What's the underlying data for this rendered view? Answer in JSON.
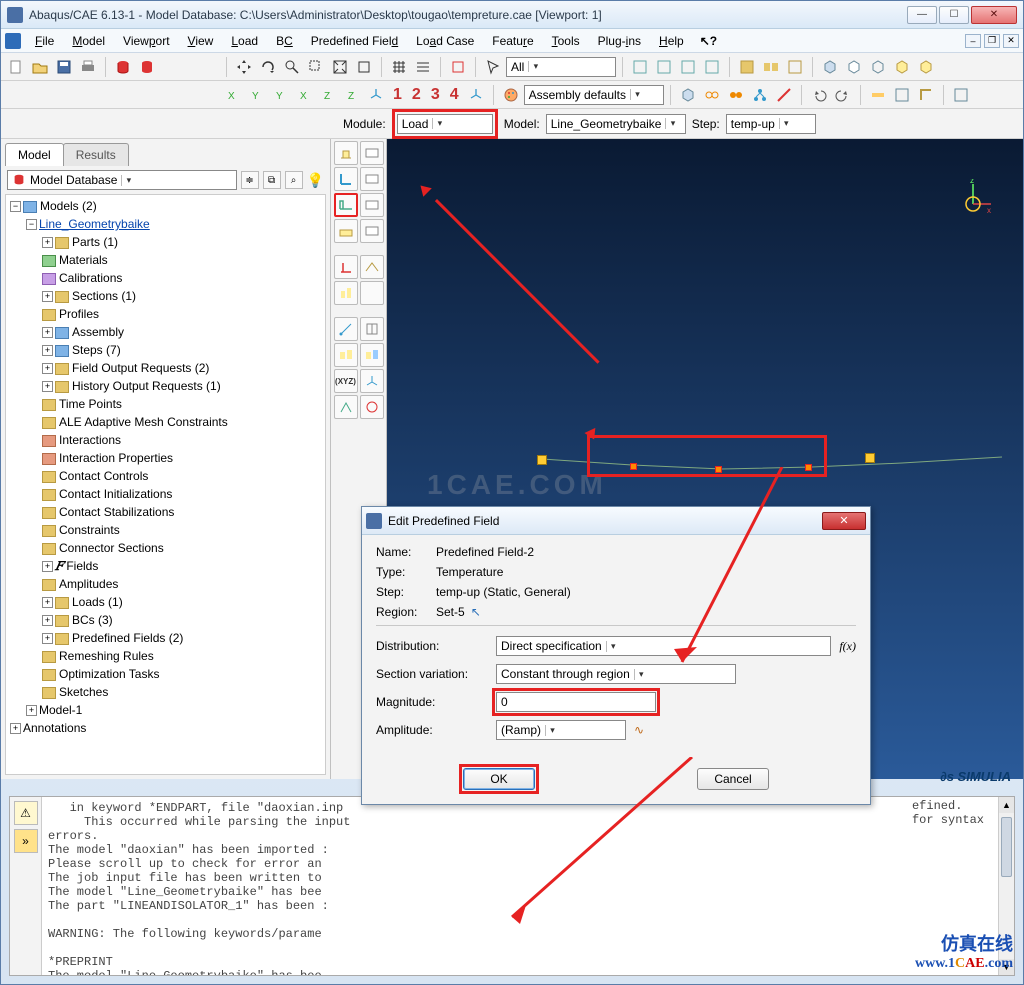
{
  "window": {
    "title": "Abaqus/CAE 6.13-1 - Model Database: C:\\Users\\Administrator\\Desktop\\tougao\\tempreture.cae [Viewport: 1]",
    "min": "—",
    "max": "☐",
    "close": "✕"
  },
  "menus": [
    "File",
    "Model",
    "Viewport",
    "View",
    "Load",
    "BC",
    "Predefined Field",
    "Load Case",
    "Feature",
    "Tools",
    "Plug-ins",
    "Help"
  ],
  "help_cursor": "↖?",
  "view_combo": "All",
  "assembly_combo": "Assembly defaults",
  "steps_nums": [
    "1",
    "2",
    "3",
    "4"
  ],
  "context": {
    "module_label": "Module:",
    "module_value": "Load",
    "model_label": "Model:",
    "model_value": "Line_Geometrybaike",
    "step_label": "Step:",
    "step_value": "temp-up"
  },
  "side": {
    "tab_model": "Model",
    "tab_results": "Results",
    "db_label": "Model Database"
  },
  "tree": {
    "root": "Models (2)",
    "model_a": "Line_Geometrybaike",
    "parts": "Parts (1)",
    "materials": "Materials",
    "calibrations": "Calibrations",
    "sections": "Sections (1)",
    "profiles": "Profiles",
    "assembly": "Assembly",
    "steps": "Steps (7)",
    "for": "Field Output Requests (2)",
    "hor": "History Output Requests (1)",
    "timepoints": "Time Points",
    "ale": "ALE Adaptive Mesh Constraints",
    "interactions": "Interactions",
    "interprops": "Interaction Properties",
    "contactctrls": "Contact Controls",
    "contactinits": "Contact Initializations",
    "contactstabs": "Contact Stabilizations",
    "constraints": "Constraints",
    "connsecs": "Connector Sections",
    "fields": "Fields",
    "amplitudes": "Amplitudes",
    "loads": "Loads (1)",
    "bcs": "BCs (3)",
    "predef": "Predefined Fields (2)",
    "remesh": "Remeshing Rules",
    "opt": "Optimization Tasks",
    "sketches": "Sketches",
    "model_b": "Model-1",
    "annotations": "Annotations"
  },
  "tool_xyz": "(XYZ)",
  "dialog": {
    "title": "Edit Predefined Field",
    "name_k": "Name:",
    "name_v": "Predefined Field-2",
    "type_k": "Type:",
    "type_v": "Temperature",
    "step_k": "Step:",
    "step_v": "temp-up (Static, General)",
    "region_k": "Region:",
    "region_v": "Set-5",
    "dist_k": "Distribution:",
    "dist_v": "Direct specification",
    "secv_k": "Section variation:",
    "secv_v": "Constant through region",
    "mag_k": "Magnitude:",
    "mag_v": "0",
    "amp_k": "Amplitude:",
    "amp_v": "(Ramp)",
    "fx": "f(x)",
    "ok": "OK",
    "cancel": "Cancel"
  },
  "msg_lines": "   in keyword *ENDPART, file \"daoxian.inp\n     This occurred while parsing the input\nerrors.\nThe model \"daoxian\" has been imported :\nPlease scroll up to check for error an\nThe job input file has been written to\nThe model \"Line_Geometrybaike\" has bee\nThe part \"LINEANDISOLATOR_1\" has been :\n\nWARNING: The following keywords/parame\n\n*PREPRINT\nThe model \"Line_Geometrybaike\" has bee\nPlease scroll up to check for error and warning messages.\n",
  "msg_tail1": "efined.",
  "msg_tail2": "for syntax",
  "simulia_ds": "∂s",
  "simulia": "SIMULIA",
  "footer_cn": "仿真在线",
  "footer_url_w": "www.",
  "footer_url_1": "1",
  "footer_url_c": "C",
  "footer_url_ae": "AE",
  "footer_url_com": ".com"
}
